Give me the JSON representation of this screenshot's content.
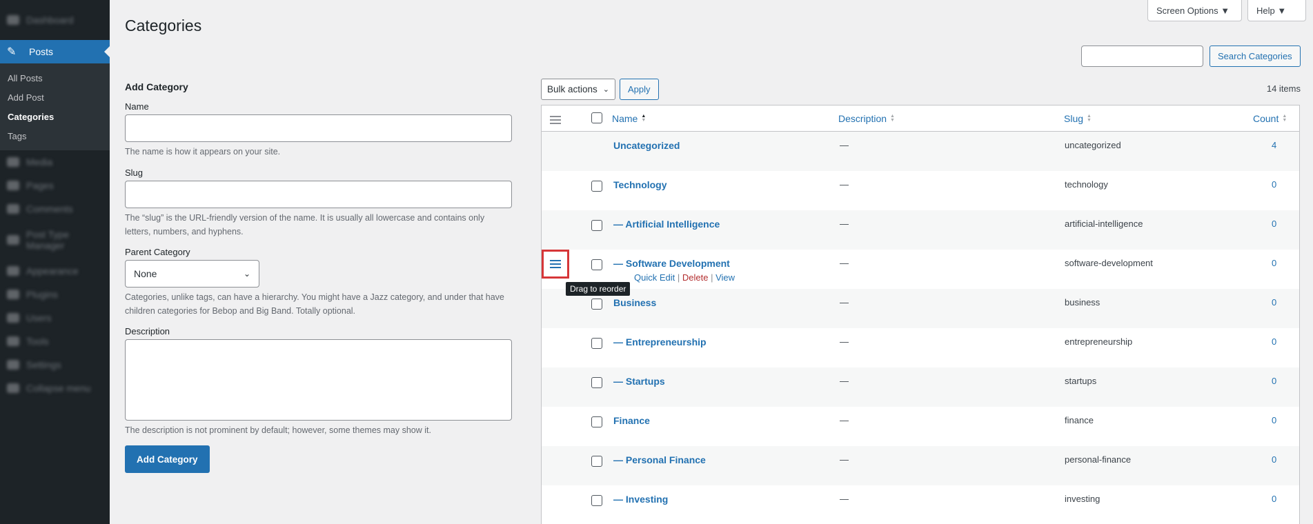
{
  "sidebar": {
    "blurred_top": "Dashboard",
    "active": "Posts",
    "submenu": [
      "All Posts",
      "Add Post",
      "Categories",
      "Tags"
    ],
    "blurred_rest": [
      "Media",
      "Pages",
      "Comments",
      "Post Type Manager",
      "Appearance",
      "Plugins",
      "Users",
      "Tools",
      "Settings",
      "Collapse menu"
    ]
  },
  "header": {
    "screen_options": "Screen Options ▼",
    "help": "Help ▼",
    "title": "Categories"
  },
  "search": {
    "button": "Search Categories",
    "value": ""
  },
  "form": {
    "heading": "Add Category",
    "name_label": "Name",
    "name_help": "The name is how it appears on your site.",
    "slug_label": "Slug",
    "slug_help": "The “slug” is the URL-friendly version of the name. It is usually all lowercase and contains only letters, numbers, and hyphens.",
    "parent_label": "Parent Category",
    "parent_value": "None",
    "parent_help": "Categories, unlike tags, can have a hierarchy. You might have a Jazz category, and under that have children categories for Bebop and Big Band. Totally optional.",
    "desc_label": "Description",
    "desc_help": "The description is not prominent by default; however, some themes may show it.",
    "submit": "Add Category"
  },
  "tablenav": {
    "bulk": "Bulk actions",
    "apply": "Apply",
    "count": "14 items"
  },
  "columns": {
    "name": "Name",
    "description": "Description",
    "slug": "Slug",
    "count": "Count"
  },
  "rows": [
    {
      "name": "Uncategorized",
      "desc": "—",
      "slug": "uncategorized",
      "count": "4"
    },
    {
      "name": "Technology",
      "desc": "—",
      "slug": "technology",
      "count": "0"
    },
    {
      "name": "— Artificial Intelligence",
      "desc": "—",
      "slug": "artificial-intelligence",
      "count": "0"
    },
    {
      "name": "— Software Development",
      "desc": "—",
      "slug": "software-development",
      "count": "0"
    },
    {
      "name": "Business",
      "desc": "—",
      "slug": "business",
      "count": "0"
    },
    {
      "name": "— Entrepreneurship",
      "desc": "—",
      "slug": "entrepreneurship",
      "count": "0"
    },
    {
      "name": "— Startups",
      "desc": "—",
      "slug": "startups",
      "count": "0"
    },
    {
      "name": "Finance",
      "desc": "—",
      "slug": "finance",
      "count": "0"
    },
    {
      "name": "— Personal Finance",
      "desc": "—",
      "slug": "personal-finance",
      "count": "0"
    },
    {
      "name": "— Investing",
      "desc": "—",
      "slug": "investing",
      "count": "0"
    }
  ],
  "row_actions": {
    "quick_edit": "Quick Edit",
    "delete": "Delete",
    "view": "View",
    "sep": "|"
  },
  "tooltip": "Drag to reorder"
}
